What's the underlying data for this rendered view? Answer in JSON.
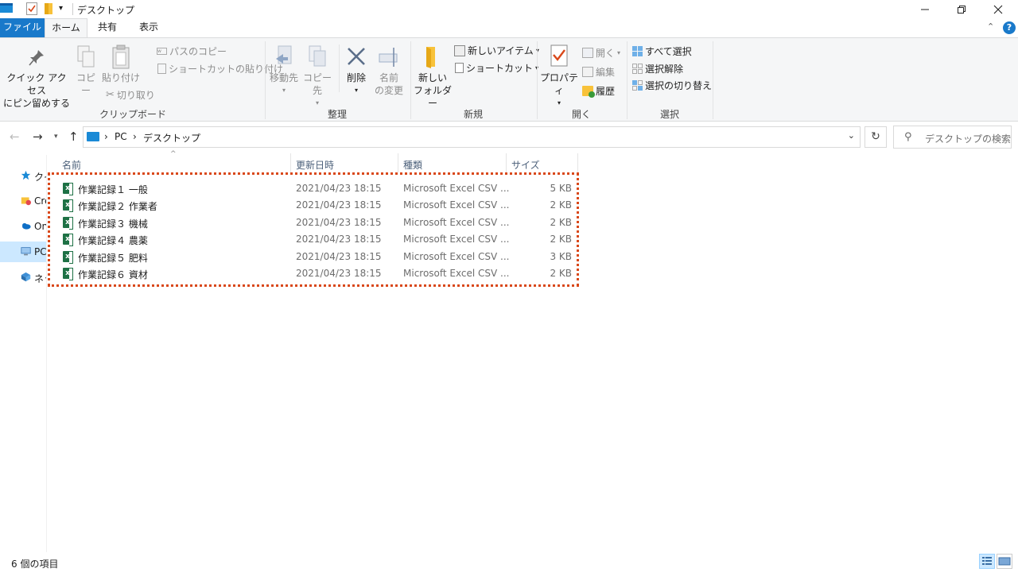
{
  "window": {
    "title": "デスクトップ",
    "controls": [
      "minimize",
      "restore",
      "close"
    ]
  },
  "tabs": {
    "file": "ファイル",
    "home": "ホーム",
    "share": "共有",
    "view": "表示"
  },
  "ribbon": {
    "clipboard": {
      "label": "クリップボード",
      "pin_line1": "クイック アクセス",
      "pin_line2": "にピン留めする",
      "copy": "コピー",
      "paste": "貼り付け",
      "cut": "切り取り",
      "copy_path": "パスのコピー",
      "paste_shortcut": "ショートカットの貼り付け"
    },
    "organize": {
      "label": "整理",
      "move_to": "移動先",
      "copy_to": "コピー先",
      "delete": "削除",
      "rename_line1": "名前",
      "rename_line2": "の変更"
    },
    "new": {
      "label": "新規",
      "new_folder_line1": "新しい",
      "new_folder_line2": "フォルダー",
      "new_item": "新しいアイテム",
      "shortcut": "ショートカット"
    },
    "open": {
      "label": "開く",
      "properties": "プロパティ",
      "open": "開く",
      "edit": "編集",
      "history": "履歴"
    },
    "select": {
      "label": "選択",
      "select_all": "すべて選択",
      "select_none": "選択解除",
      "invert": "選択の切り替え"
    }
  },
  "address": {
    "crumbs": [
      "PC",
      "デスクトップ"
    ],
    "search_placeholder": "デスクトップの検索"
  },
  "nav": {
    "items": [
      {
        "label": "クイック アクセス",
        "icon": "star-icon"
      },
      {
        "label": "Creative Cloud Files",
        "icon": "creative-cloud-icon"
      },
      {
        "label": "OneDrive",
        "icon": "cloud-icon"
      },
      {
        "label": "PC",
        "icon": "pc-icon"
      },
      {
        "label": "ネットワーク",
        "icon": "network-icon"
      }
    ]
  },
  "columns": {
    "name": "名前",
    "date": "更新日時",
    "type": "種類",
    "size": "サイズ"
  },
  "files": [
    {
      "name": "作業記録１ 一般",
      "date": "2021/04/23 18:15",
      "type": "Microsoft Excel CSV ...",
      "size": "5 KB"
    },
    {
      "name": "作業記録２ 作業者",
      "date": "2021/04/23 18:15",
      "type": "Microsoft Excel CSV ...",
      "size": "2 KB"
    },
    {
      "name": "作業記録３ 機械",
      "date": "2021/04/23 18:15",
      "type": "Microsoft Excel CSV ...",
      "size": "2 KB"
    },
    {
      "name": "作業記録４ 農薬",
      "date": "2021/04/23 18:15",
      "type": "Microsoft Excel CSV ...",
      "size": "2 KB"
    },
    {
      "name": "作業記録５ 肥料",
      "date": "2021/04/23 18:15",
      "type": "Microsoft Excel CSV ...",
      "size": "3 KB"
    },
    {
      "name": "作業記録６ 資材",
      "date": "2021/04/23 18:15",
      "type": "Microsoft Excel CSV ...",
      "size": "2 KB"
    }
  ],
  "status": {
    "count": "6 個の項目"
  },
  "colors": {
    "accent": "#1979ca",
    "highlight": "#d9481a",
    "selection": "#cce8ff"
  }
}
